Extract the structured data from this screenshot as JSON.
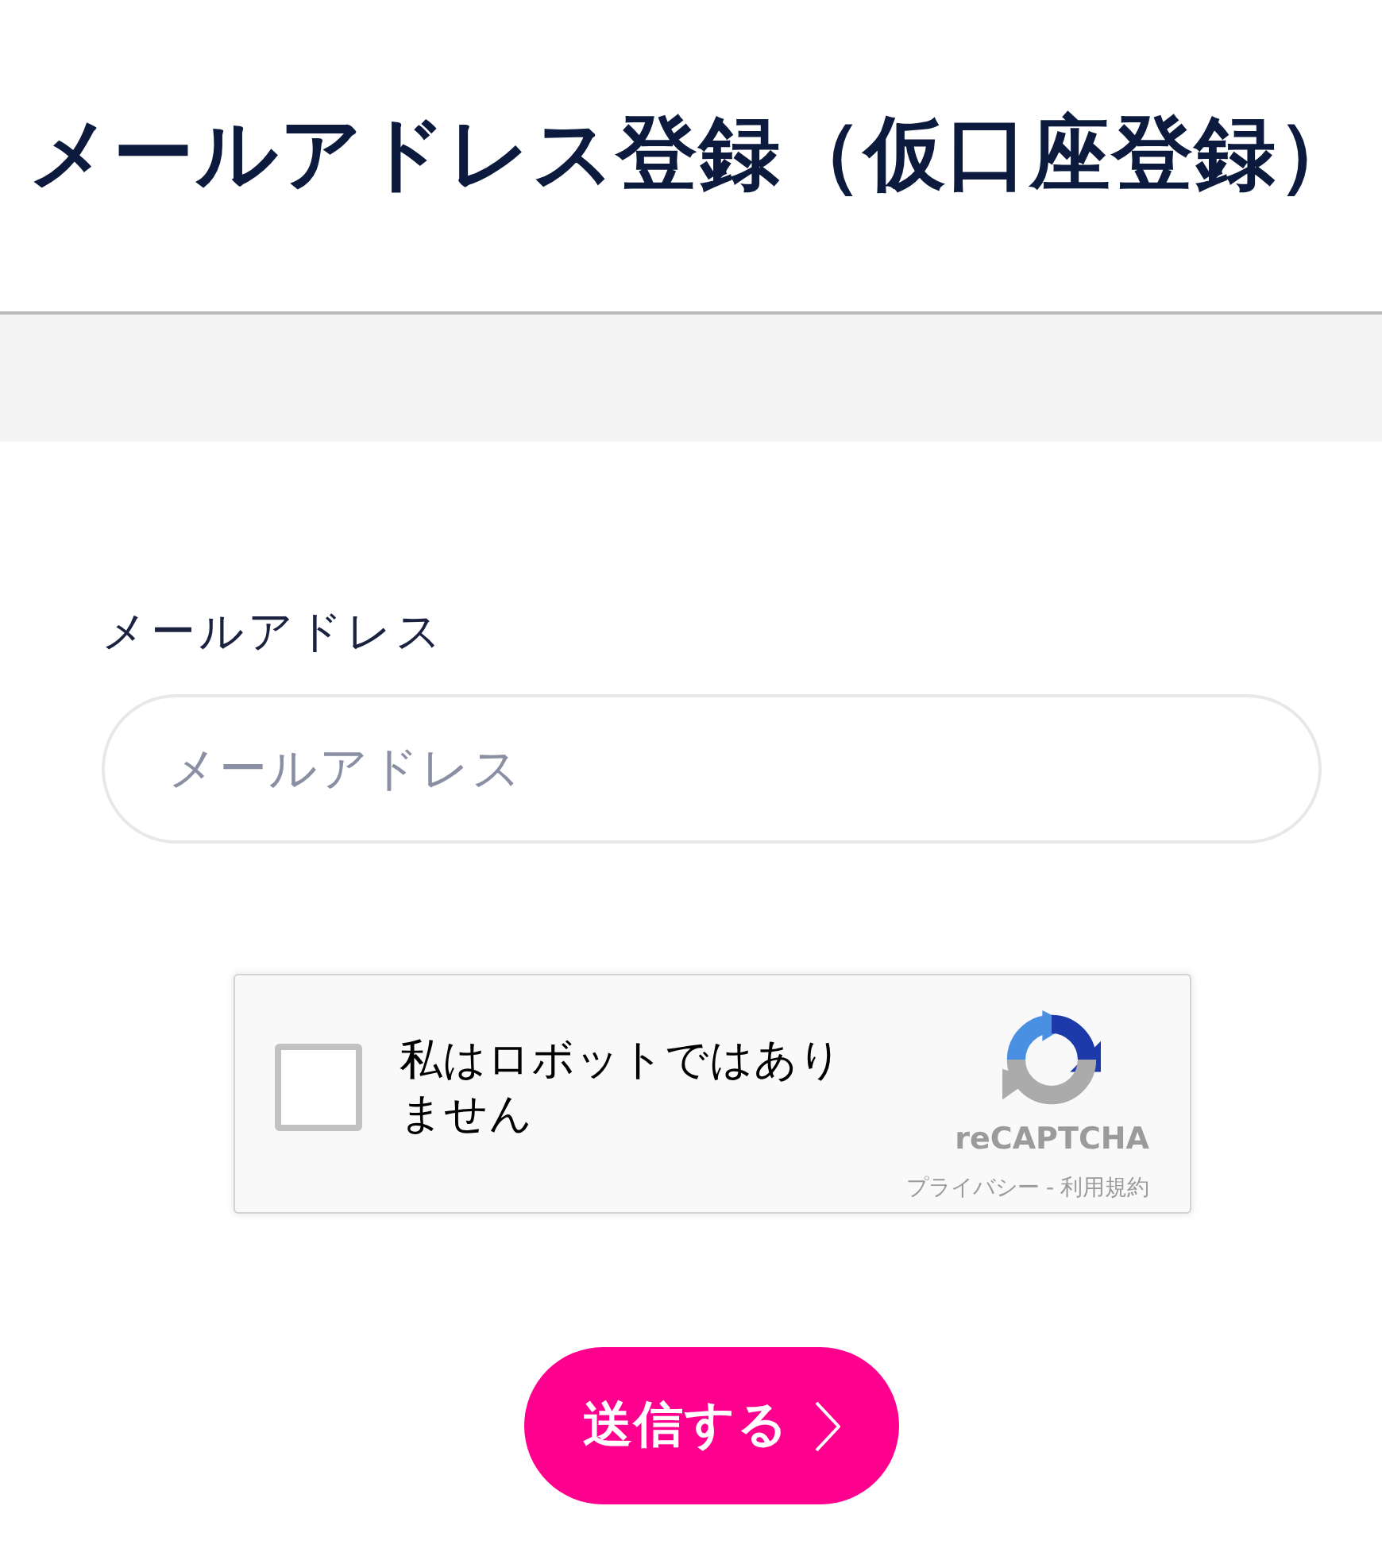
{
  "page_title": "メールアドレス登録（仮口座登録）",
  "form": {
    "email_label": "メールアドレス",
    "email_field": {
      "placeholder": "メールアドレス"
    }
  },
  "captcha": {
    "checked": false,
    "label": "私はロボットではありません",
    "brand": "reCAPTCHA",
    "privacy_link": "プライバシー",
    "separator": "-",
    "terms_link": "利用規約"
  },
  "submit_button": {
    "label": "送信する"
  }
}
